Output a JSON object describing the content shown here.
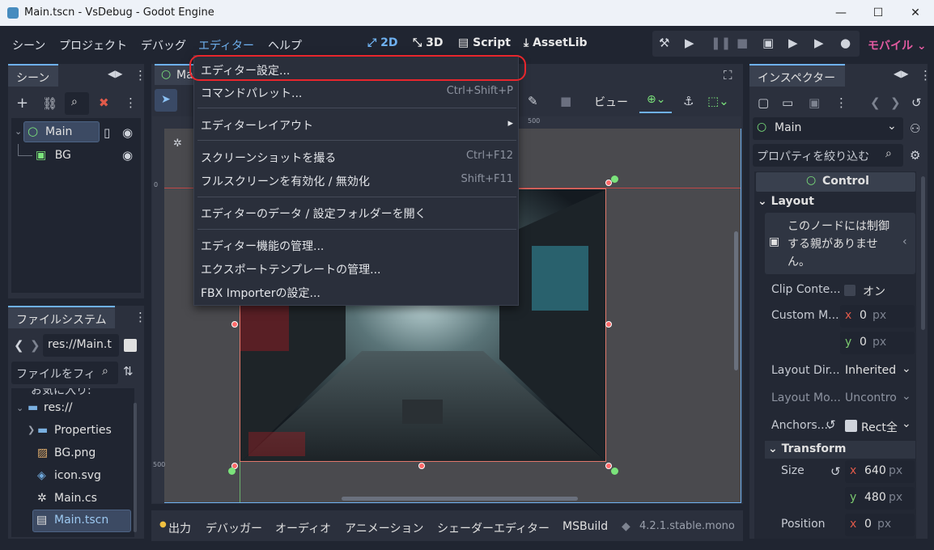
{
  "window": {
    "title": "Main.tscn - VsDebug - Godot Engine"
  },
  "menubar": {
    "items": [
      "シーン",
      "プロジェクト",
      "デバッグ",
      "エディター",
      "ヘルプ"
    ],
    "modes": [
      "2D",
      "3D",
      "Script",
      "AssetLib"
    ],
    "renderer": "モバイル"
  },
  "scene_dock": {
    "tab": "シーン",
    "nodes": [
      {
        "label": "Main"
      },
      {
        "label": "BG"
      }
    ]
  },
  "filesystem_dock": {
    "tab": "ファイルシステム",
    "path": "res://Main.t",
    "filter_placeholder": "ファイルをフィ",
    "partial_item": "お気に入り:",
    "items": [
      "res://",
      "Properties",
      "BG.png",
      "icon.svg",
      "Main.cs",
      "Main.tscn"
    ]
  },
  "viewport": {
    "tab_partial": "Ma",
    "view_button": "ビュー",
    "ruler_marks": [
      "500",
      "0",
      "500"
    ]
  },
  "context_menu": {
    "items": [
      {
        "label": "エディター設定...",
        "shortcut": ""
      },
      {
        "label": "コマンドパレット...",
        "shortcut": "Ctrl+Shift+P"
      },
      {
        "label": "エディターレイアウト",
        "shortcut": ""
      },
      {
        "label": "スクリーンショットを撮る",
        "shortcut": "Ctrl+F12"
      },
      {
        "label": "フルスクリーンを有効化 / 無効化",
        "shortcut": "Shift+F11"
      },
      {
        "label": "エディターのデータ / 設定フォルダーを開く",
        "shortcut": ""
      },
      {
        "label": "エディター機能の管理...",
        "shortcut": ""
      },
      {
        "label": "エクスポートテンプレートの管理...",
        "shortcut": ""
      },
      {
        "label": "FBX Importerの設定...",
        "shortcut": ""
      }
    ]
  },
  "bottom_panel": {
    "tabs": [
      "出力",
      "デバッガー",
      "オーディオ",
      "アニメーション",
      "シェーダーエディター",
      "MSBuild"
    ],
    "version": "4.2.1.stable.mono"
  },
  "inspector": {
    "tab": "インスペクター",
    "node": "Main",
    "filter_placeholder": "プロパティを絞り込む",
    "class": "Control",
    "section_layout": "Layout",
    "warning": "このノードには制御する親がありません。",
    "props": {
      "clip_label": "Clip Conte...",
      "clip_value": "オン",
      "custom_label": "Custom M...",
      "custom_x": "0",
      "custom_y": "0",
      "layout_dir_label": "Layout Dir...",
      "layout_dir_value": "Inherited",
      "layout_mode_label": "Layout Mo...",
      "layout_mode_value": "Uncontro",
      "anchors_label": "Anchors....",
      "anchors_value": "Rect全",
      "transform_label": "Transform",
      "size_label": "Size",
      "size_x": "640",
      "size_y": "480",
      "position_label": "Position",
      "position_x": "0",
      "unit": "px",
      "x": "x",
      "y": "y"
    }
  },
  "colors": {
    "accent": "#6fb1f0",
    "highlight": "#e8262c",
    "control": "#7be37b"
  }
}
